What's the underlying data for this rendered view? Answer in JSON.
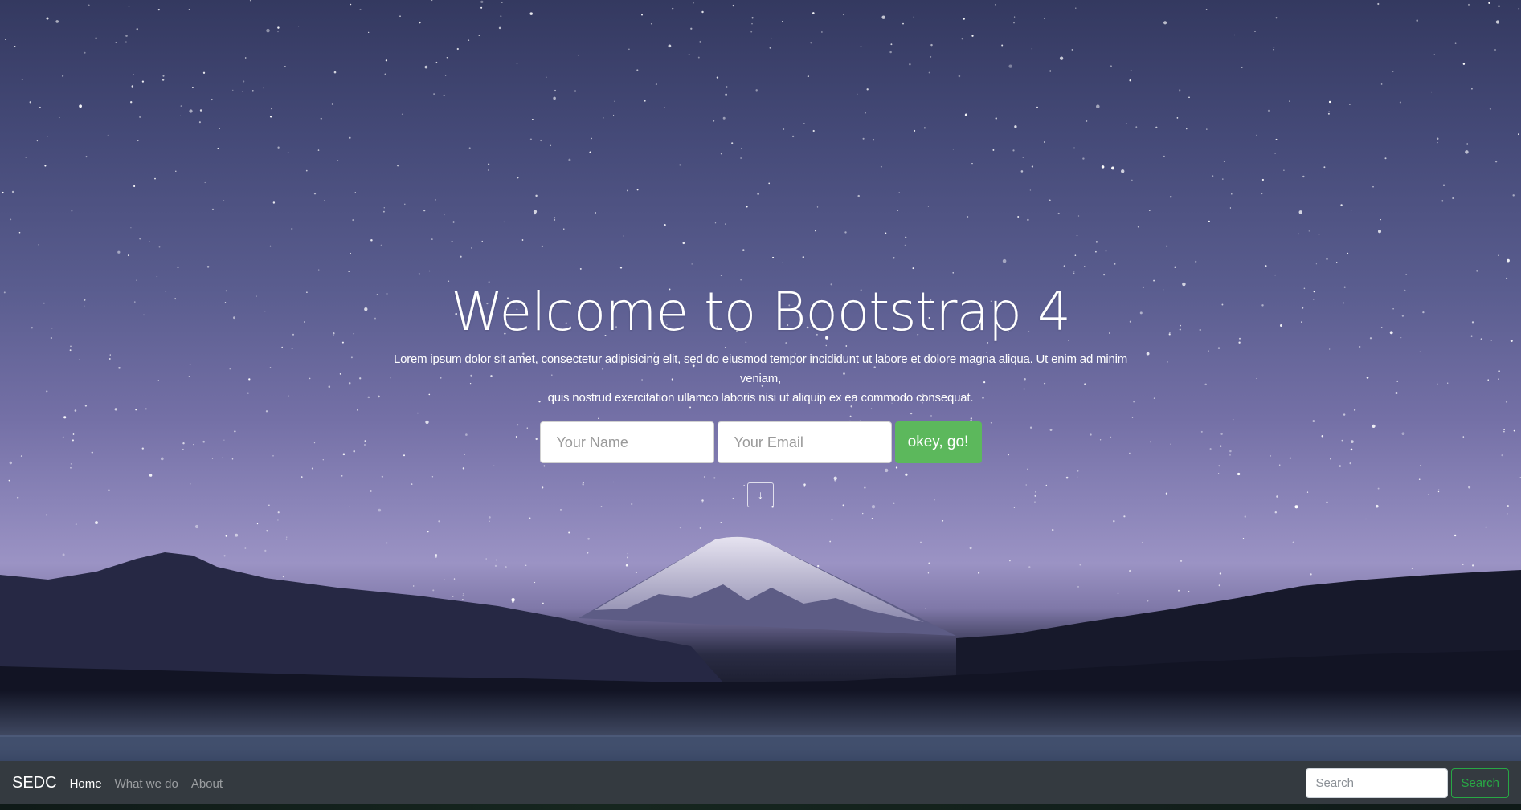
{
  "hero": {
    "title": "Welcome to Bootstrap 4",
    "lead_line1": "Lorem ipsum dolor sit amet, consectetur adipisicing elit, sed do eiusmod tempor incididunt ut labore et dolore magna aliqua. Ut enim ad minim veniam,",
    "lead_line2": "quis nostrud exercitation ullamco laboris nisi ut aliquip ex ea commodo consequat.",
    "name_placeholder": "Your Name",
    "email_placeholder": "Your Email",
    "submit_label": "okey, go!",
    "scroll_down_icon": "arrow-down-icon",
    "scroll_down_glyph": "↓"
  },
  "navbar": {
    "brand": "SEDC",
    "links": [
      {
        "label": "Home",
        "active": true
      },
      {
        "label": "What we do",
        "active": false
      },
      {
        "label": "About",
        "active": false
      }
    ],
    "search_placeholder": "Search",
    "search_button_label": "Search"
  },
  "colors": {
    "navbar_bg": "#343a40",
    "submit_bg": "#5cb85c",
    "search_button": "#28a745",
    "text_primary": "#ffffff"
  }
}
